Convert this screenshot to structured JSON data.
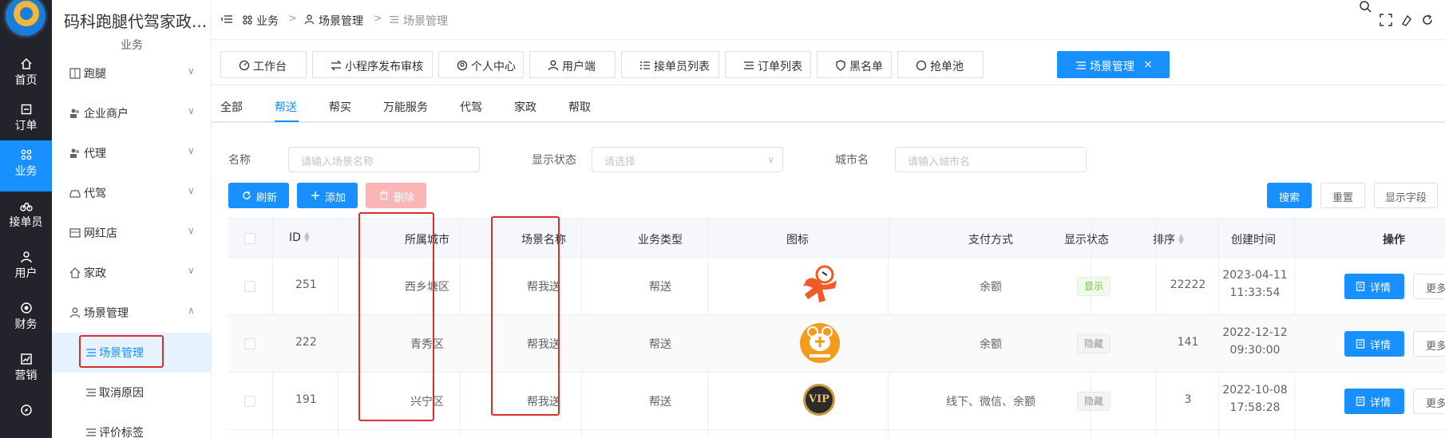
{
  "rail": {
    "items": [
      {
        "label": "首页",
        "icon": "home-icon"
      },
      {
        "label": "订单",
        "icon": "order-icon"
      },
      {
        "label": "业务",
        "icon": "business-icon"
      },
      {
        "label": "接单员",
        "icon": "bike-icon"
      },
      {
        "label": "用户",
        "icon": "user-icon"
      },
      {
        "label": "财务",
        "icon": "finance-icon"
      },
      {
        "label": "营销",
        "icon": "chart-icon"
      }
    ]
  },
  "sidebar": {
    "brand": "码科跑腿代驾家政...",
    "section": "业务",
    "items": [
      {
        "label": "跑腿"
      },
      {
        "label": "企业商户"
      },
      {
        "label": "代理"
      },
      {
        "label": "代驾"
      },
      {
        "label": "网红店"
      },
      {
        "label": "家政"
      },
      {
        "label": "场景管理"
      },
      {
        "label": "场景管理"
      },
      {
        "label": "取消原因"
      },
      {
        "label": "评价标签"
      }
    ]
  },
  "header": {
    "crumbs": [
      "业务",
      "场景管理",
      "场景管理"
    ],
    "separator": ">"
  },
  "tags": [
    "工作台",
    "小程序发布审核",
    "个人中心",
    "用户端",
    "接单员列表",
    "订单列表",
    "黑名单",
    "抢单池",
    "场景管理"
  ],
  "tag_close": "×",
  "subtabs": [
    "全部",
    "帮送",
    "帮买",
    "万能服务",
    "代驾",
    "家政",
    "帮取"
  ],
  "filters": {
    "name_label": "名称",
    "name_placeholder": "请输入场景名称",
    "status_label": "显示状态",
    "status_placeholder": "请选择",
    "city_label": "城市名",
    "city_placeholder": "请输入城市名"
  },
  "buttons": {
    "refresh": "刷新",
    "add": "添加",
    "delete": "删除",
    "search": "搜索",
    "reset": "重置",
    "fields": "显示字段"
  },
  "table": {
    "headers": {
      "id": "ID",
      "city": "所属城市",
      "scene": "场景名称",
      "biz": "业务类型",
      "icon": "图标",
      "pay": "支付方式",
      "status": "显示状态",
      "sort": "排序",
      "created": "创建时间",
      "ops": "操作"
    },
    "detail_label": "详情",
    "more_label": "更多",
    "rows": [
      {
        "id": "251",
        "city": "西乡塘区",
        "scene": "帮我送",
        "biz": "帮送",
        "pay": "余额",
        "status": "显示",
        "status_type": "show",
        "sort": "22222",
        "date": "2023-04-11",
        "time": "11:33:54",
        "icon_text": ""
      },
      {
        "id": "222",
        "city": "青秀区",
        "scene": "帮我送",
        "biz": "帮送",
        "pay": "余额",
        "status": "隐藏",
        "status_type": "hide",
        "sort": "141",
        "date": "2022-12-12",
        "time": "09:30:00",
        "icon_text": ""
      },
      {
        "id": "191",
        "city": "兴宁区",
        "scene": "帮我送",
        "biz": "帮送",
        "pay": "线下、微信、余额",
        "status": "隐藏",
        "status_type": "hide",
        "sort": "3",
        "date": "2022-10-08",
        "time": "17:58:28",
        "icon_text": "VIP"
      }
    ]
  },
  "colors": {
    "primary": "#1890ff",
    "rail": "#23232b",
    "highlight": "#d9302b"
  }
}
